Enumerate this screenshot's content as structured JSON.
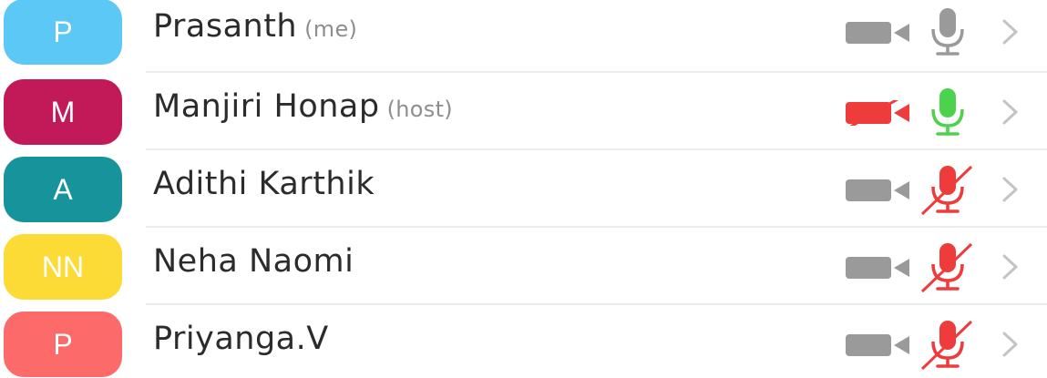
{
  "participants": [
    {
      "initials": "P",
      "name": "Prasanth",
      "role": "(me)",
      "avatar_color": "#5bc8f5",
      "video_on": true,
      "audio_state": "on",
      "camera_icon": "video-camera-icon",
      "mic_icon": "microphone-icon"
    },
    {
      "initials": "M",
      "name": "Manjiri Honap",
      "role": "(host)",
      "avatar_color": "#c21a59",
      "video_on": false,
      "audio_state": "speaking",
      "camera_icon": "video-camera-off-icon",
      "mic_icon": "microphone-active-icon"
    },
    {
      "initials": "A",
      "name": "Adithi Karthik",
      "role": "",
      "avatar_color": "#17939c",
      "video_on": true,
      "audio_state": "muted",
      "camera_icon": "video-camera-icon",
      "mic_icon": "microphone-muted-icon"
    },
    {
      "initials": "NN",
      "name": "Neha Naomi",
      "role": "",
      "avatar_color": "#fcdb36",
      "video_on": true,
      "audio_state": "muted",
      "camera_icon": "video-camera-icon",
      "mic_icon": "microphone-muted-icon"
    },
    {
      "initials": "P",
      "name": "Priyanga.V",
      "role": "",
      "avatar_color": "#fc6a6a",
      "video_on": true,
      "audio_state": "muted",
      "camera_icon": "video-camera-icon",
      "mic_icon": "microphone-muted-icon"
    }
  ],
  "colors": {
    "icon_gray": "#9a9a9a",
    "off_red": "#ee3b3b",
    "active_green": "#4cd24c",
    "chevron_gray": "#c4c4c4",
    "name_text": "#2b2b2b",
    "role_text": "#8e8e8e"
  }
}
